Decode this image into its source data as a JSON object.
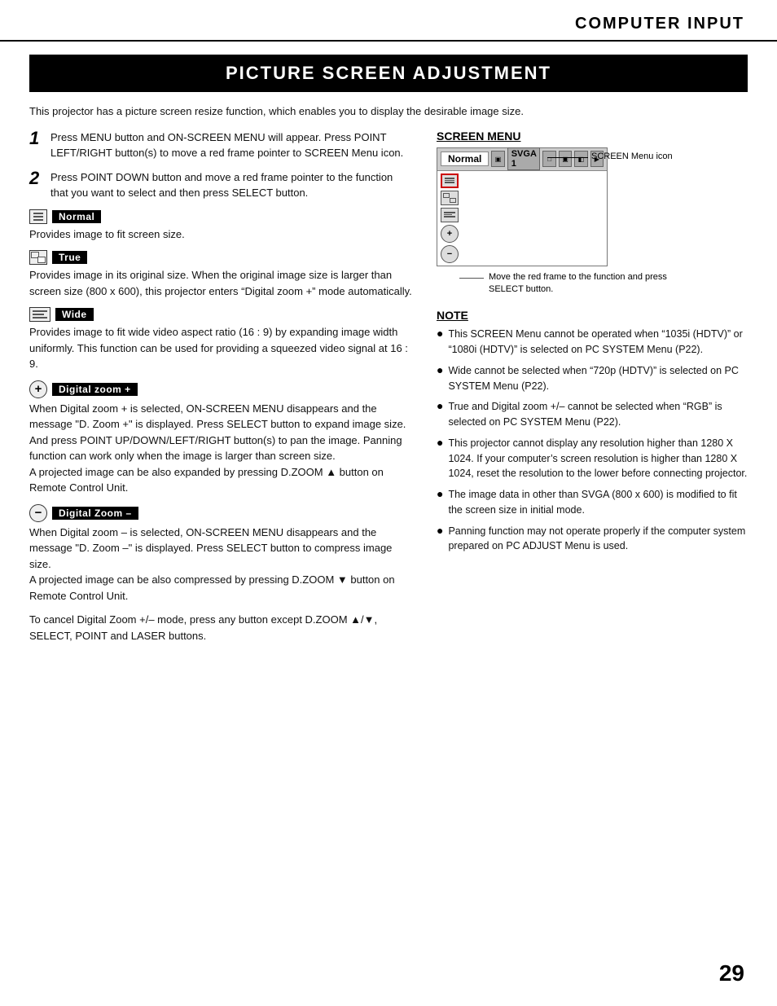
{
  "header": {
    "title": "COMPUTER INPUT"
  },
  "section": {
    "title": "PICTURE SCREEN ADJUSTMENT"
  },
  "intro": "This projector has a picture screen resize function, which enables you to display the desirable image size.",
  "steps": [
    {
      "num": "1",
      "text": "Press MENU button and ON-SCREEN MENU will appear.  Press POINT LEFT/RIGHT button(s) to move a red frame pointer to SCREEN Menu icon."
    },
    {
      "num": "2",
      "text": "Press POINT DOWN button and move a red frame pointer to the function that you want to select and then press SELECT button."
    }
  ],
  "modes": [
    {
      "id": "normal",
      "label": "Normal",
      "desc": "Provides image to fit screen size."
    },
    {
      "id": "true",
      "label": "True",
      "desc": "Provides image in its original size.  When the original image size is larger than screen size (800 x 600), this projector enters “Digital zoom +” mode automatically."
    },
    {
      "id": "wide",
      "label": "Wide",
      "desc": "Provides image to fit wide video aspect ratio (16 : 9) by expanding image width uniformly.   This function can be used for providing a squeezed video signal at 16 : 9."
    },
    {
      "id": "digital-zoom-plus",
      "label": "Digital zoom +",
      "desc": "When Digital zoom + is selected, ON-SCREEN MENU disappears and the message “D. Zoom +” is displayed.  Press SELECT button to expand image size.   And press POINT UP/DOWN/LEFT/RIGHT button(s) to pan the image.   Panning function can work only when the image is larger than screen size.\nA projected image can be also expanded by pressing D.ZOOM ▲ button on Remote Control Unit."
    },
    {
      "id": "digital-zoom-minus",
      "label": "Digital Zoom –",
      "desc": "When Digital zoom – is selected, ON-SCREEN MENU disappears and the message “D. Zoom –” is displayed.  Press SELECT button to compress image size.\nA projected image can be also compressed by pressing D.ZOOM ▼ button on Remote Control Unit."
    }
  ],
  "cancel_text": "To cancel Digital Zoom +/– mode, press any button except D.ZOOM ▲/▼, SELECT, POINT and LASER buttons.",
  "screen_menu": {
    "label": "SCREEN MENU",
    "normal_label": "Normal",
    "svga_label": "SVGA 1",
    "icon_label": "SCREEN Menu icon",
    "move_label": "Move the red frame to the function and press SELECT button."
  },
  "note": {
    "title": "NOTE",
    "items": [
      "This SCREEN Menu cannot be operated when “1035i (HDTV)” or “1080i (HDTV)” is selected on PC SYSTEM Menu  (P22).",
      "Wide cannot be selected when “720p (HDTV)” is selected on PC SYSTEM Menu  (P22).",
      "True and Digital zoom +/– cannot be selected when “RGB” is selected on PC SYSTEM Menu (P22).",
      "This projector cannot display any resolution higher than 1280 X 1024.   If your computer’s screen resolution is higher than 1280 X 1024, reset the resolution to the lower before connecting projector.",
      "The image data in other than SVGA (800 x 600) is modified to fit the screen size in initial mode.",
      "Panning function may not operate properly if the computer system prepared on PC ADJUST Menu is used."
    ]
  },
  "page_number": "29"
}
